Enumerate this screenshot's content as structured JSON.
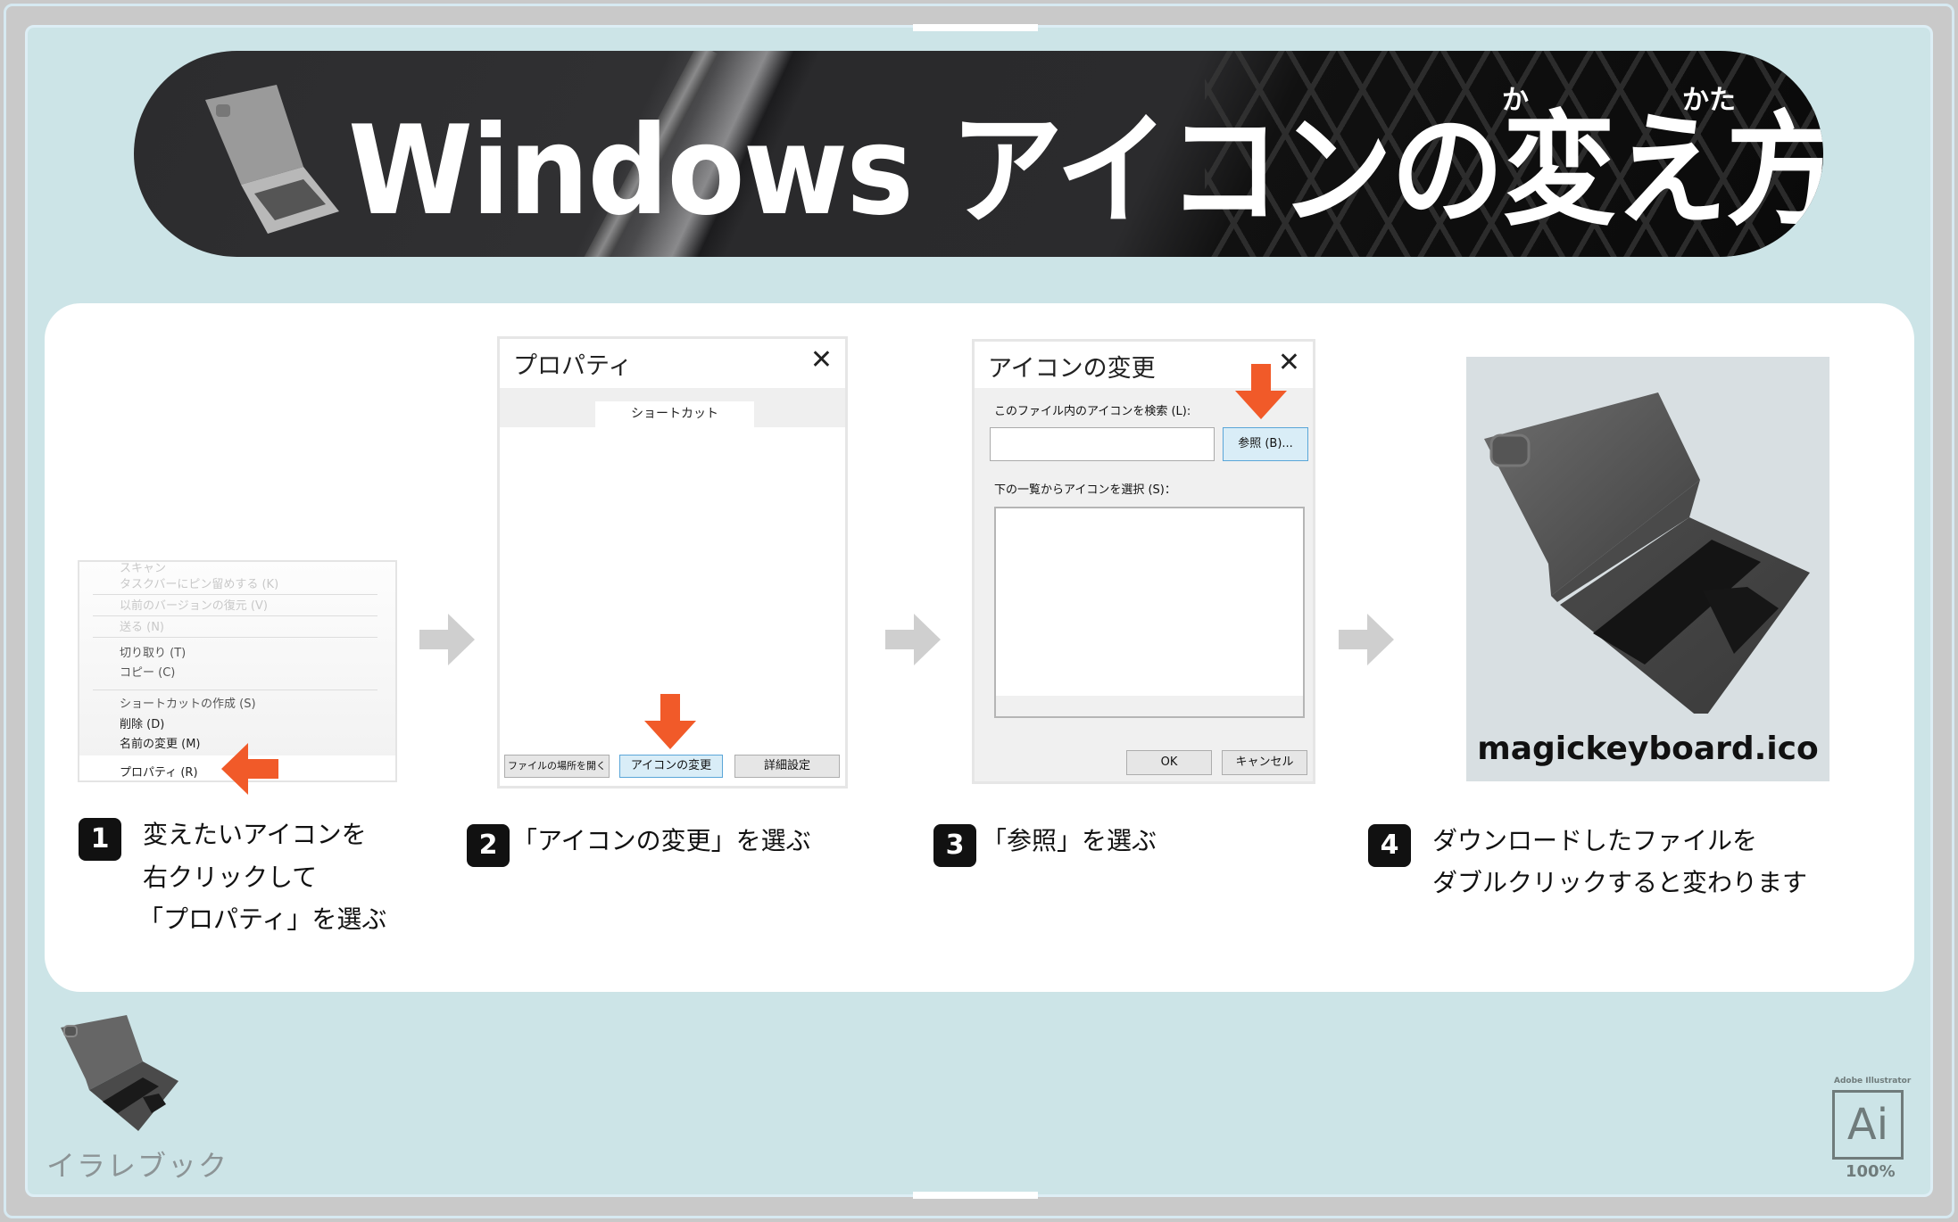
{
  "banner": {
    "title": "Windows アイコンの変え方",
    "ruby_ka": "か",
    "ruby_kata": "かた"
  },
  "step1": {
    "number": "1",
    "lines": [
      "変えたいアイコンを",
      "右クリックして",
      "「プロパティ」を選ぶ"
    ],
    "menu": {
      "items": [
        {
          "label": "スキャン",
          "state": "faded"
        },
        {
          "label": "タスクバーにピン留めする (K)",
          "state": "faded"
        },
        {
          "label": "以前のバージョンの復元 (V)",
          "state": "faded"
        },
        {
          "label": "送る (N)",
          "state": "faded"
        },
        {
          "label": "切り取り (T)",
          "state": "mid"
        },
        {
          "label": "コピー (C)",
          "state": "mid"
        },
        {
          "label": "ショートカットの作成 (S)",
          "state": "mid"
        },
        {
          "label": "削除 (D)",
          "state": "normal"
        },
        {
          "label": "名前の変更 (M)",
          "state": "normal"
        },
        {
          "label": "プロパティ (R)",
          "state": "highlighted"
        }
      ]
    }
  },
  "step2": {
    "number": "2",
    "text": "「アイコンの変更」を選ぶ",
    "dialog": {
      "title": "プロパティ",
      "close": "✕",
      "tab": "ショートカット",
      "buttons": [
        "ファイルの場所を開く",
        "アイコンの変更",
        "詳細設定"
      ]
    }
  },
  "step3": {
    "number": "3",
    "text": "「参照」を選ぶ",
    "dialog": {
      "title": "アイコンの変更",
      "close": "✕",
      "search_label": "このファイル内のアイコンを検索 (L):",
      "search_value": "",
      "browse_button": "参照 (B)...",
      "list_label": "下の一覧からアイコンを選択 (S)：",
      "ok": "OK",
      "cancel": "キャンセル"
    }
  },
  "step4": {
    "number": "4",
    "lines": [
      "ダウンロードしたファイルを",
      "ダブルクリックすると変わります"
    ],
    "filename": "magickeyboard.ico"
  },
  "footer": {
    "brand": "イラレブック",
    "ai_app": "Adobe Illustrator",
    "ai_label": "Ai",
    "zoom": "100%"
  },
  "colors": {
    "accent_arrow": "#f15a29",
    "panel_bg": "#cce4e7",
    "frame": "#c9c9c9",
    "button_primary": "#d9edf7"
  }
}
